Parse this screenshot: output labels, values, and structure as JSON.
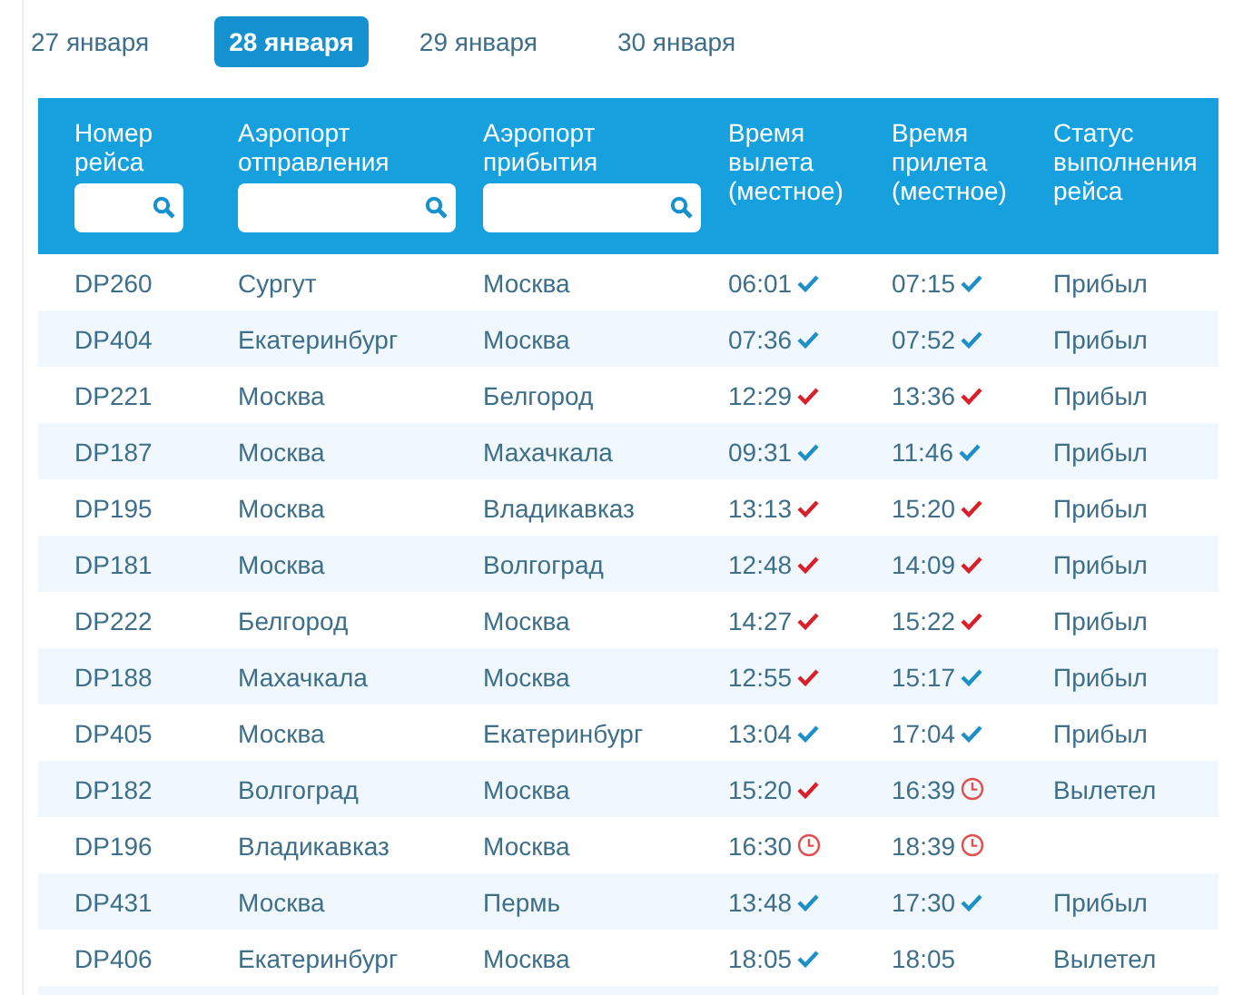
{
  "date_tabs": [
    {
      "label": "27 января",
      "selected": false
    },
    {
      "label": "28 января",
      "selected": true
    },
    {
      "label": "29 января",
      "selected": false
    },
    {
      "label": "30 января",
      "selected": false
    }
  ],
  "table": {
    "columns": [
      {
        "title": "Номер рейса",
        "filter": true
      },
      {
        "title": "Аэропорт отправления",
        "filter": true
      },
      {
        "title": "Аэропорт прибытия",
        "filter": true
      },
      {
        "title": "Время вылета (местное)",
        "filter": false
      },
      {
        "title": "Время прилета (местное)",
        "filter": false
      },
      {
        "title": "Статус выполнения рейса",
        "filter": false
      }
    ],
    "rows": [
      {
        "flight": "DP260",
        "from": "Сургут",
        "to": "Москва",
        "departure": {
          "time": "06:01",
          "kind": "on_time"
        },
        "arrival": {
          "time": "07:15",
          "kind": "on_time"
        },
        "status": "Прибыл"
      },
      {
        "flight": "DP404",
        "from": "Екатеринбург",
        "to": "Москва",
        "departure": {
          "time": "07:36",
          "kind": "on_time"
        },
        "arrival": {
          "time": "07:52",
          "kind": "on_time"
        },
        "status": "Прибыл"
      },
      {
        "flight": "DP221",
        "from": "Москва",
        "to": "Белгород",
        "departure": {
          "time": "12:29",
          "kind": "late"
        },
        "arrival": {
          "time": "13:36",
          "kind": "late"
        },
        "status": "Прибыл"
      },
      {
        "flight": "DP187",
        "from": "Москва",
        "to": "Махачкала",
        "departure": {
          "time": "09:31",
          "kind": "on_time"
        },
        "arrival": {
          "time": "11:46",
          "kind": "on_time"
        },
        "status": "Прибыл"
      },
      {
        "flight": "DP195",
        "from": "Москва",
        "to": "Владикавказ",
        "departure": {
          "time": "13:13",
          "kind": "late"
        },
        "arrival": {
          "time": "15:20",
          "kind": "late"
        },
        "status": "Прибыл"
      },
      {
        "flight": "DP181",
        "from": "Москва",
        "to": "Волгоград",
        "departure": {
          "time": "12:48",
          "kind": "late"
        },
        "arrival": {
          "time": "14:09",
          "kind": "late"
        },
        "status": "Прибыл"
      },
      {
        "flight": "DP222",
        "from": "Белгород",
        "to": "Москва",
        "departure": {
          "time": "14:27",
          "kind": "late"
        },
        "arrival": {
          "time": "15:22",
          "kind": "late"
        },
        "status": "Прибыл"
      },
      {
        "flight": "DP188",
        "from": "Махачкала",
        "to": "Москва",
        "departure": {
          "time": "12:55",
          "kind": "late"
        },
        "arrival": {
          "time": "15:17",
          "kind": "on_time"
        },
        "status": "Прибыл"
      },
      {
        "flight": "DP405",
        "from": "Москва",
        "to": "Екатеринбург",
        "departure": {
          "time": "13:04",
          "kind": "on_time"
        },
        "arrival": {
          "time": "17:04",
          "kind": "on_time"
        },
        "status": "Прибыл"
      },
      {
        "flight": "DP182",
        "from": "Волгоград",
        "to": "Москва",
        "departure": {
          "time": "15:20",
          "kind": "late"
        },
        "arrival": {
          "time": "16:39",
          "kind": "pending"
        },
        "status": "Вылетел"
      },
      {
        "flight": "DP196",
        "from": "Владикавказ",
        "to": "Москва",
        "departure": {
          "time": "16:30",
          "kind": "pending"
        },
        "arrival": {
          "time": "18:39",
          "kind": "pending"
        }
      },
      {
        "flight": "DP431",
        "from": "Москва",
        "to": "Пермь",
        "departure": {
          "time": "13:48",
          "kind": "on_time"
        },
        "arrival": {
          "time": "17:30",
          "kind": "on_time"
        },
        "status": "Прибыл"
      },
      {
        "flight": "DP406",
        "from": "Екатеринбург",
        "to": "Москва",
        "departure": {
          "time": "18:05",
          "kind": "on_time"
        },
        "arrival": {
          "time": "18:05",
          "kind": "plain"
        },
        "status": "Вылетел"
      }
    ]
  }
}
